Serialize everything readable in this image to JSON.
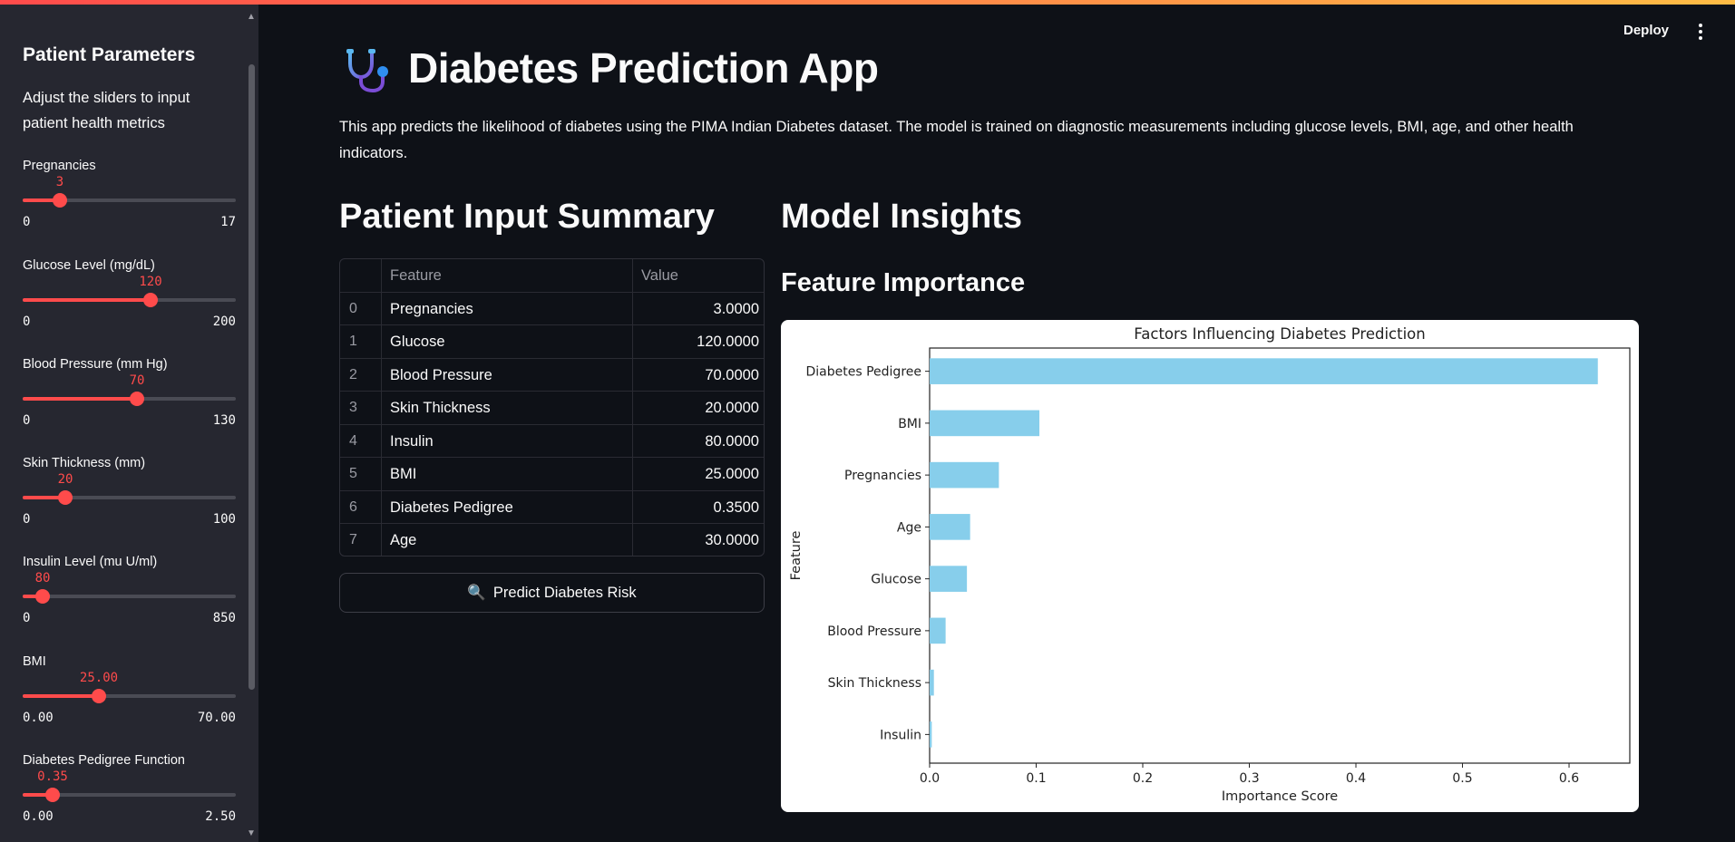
{
  "header": {
    "deploy_label": "Deploy"
  },
  "sidebar": {
    "title": "Patient Parameters",
    "description": "Adjust the sliders to input patient health metrics",
    "sliders": [
      {
        "label": "Pregnancies",
        "value": "3",
        "min": "0",
        "max": "17",
        "fraction": 0.176
      },
      {
        "label": "Glucose Level (mg/dL)",
        "value": "120",
        "min": "0",
        "max": "200",
        "fraction": 0.6
      },
      {
        "label": "Blood Pressure (mm Hg)",
        "value": "70",
        "min": "0",
        "max": "130",
        "fraction": 0.538
      },
      {
        "label": "Skin Thickness (mm)",
        "value": "20",
        "min": "0",
        "max": "100",
        "fraction": 0.2
      },
      {
        "label": "Insulin Level (mu U/ml)",
        "value": "80",
        "min": "0",
        "max": "850",
        "fraction": 0.094
      },
      {
        "label": "BMI",
        "value": "25.00",
        "min": "0.00",
        "max": "70.00",
        "fraction": 0.357
      },
      {
        "label": "Diabetes Pedigree Function",
        "value": "0.35",
        "min": "0.00",
        "max": "2.50",
        "fraction": 0.14
      }
    ]
  },
  "main": {
    "title": "Diabetes Prediction App",
    "description": "This app predicts the likelihood of diabetes using the PIMA Indian Diabetes dataset. The model is trained on diagnostic measurements including glucose levels, BMI, age, and other health indicators.",
    "left_heading": "Patient Input Summary",
    "right_heading": "Model Insights",
    "sub_heading": "Feature Importance",
    "table": {
      "columns": [
        "",
        "Feature",
        "Value"
      ],
      "rows": [
        {
          "idx": "0",
          "feature": "Pregnancies",
          "value": "3.0000"
        },
        {
          "idx": "1",
          "feature": "Glucose",
          "value": "120.0000"
        },
        {
          "idx": "2",
          "feature": "Blood Pressure",
          "value": "70.0000"
        },
        {
          "idx": "3",
          "feature": "Skin Thickness",
          "value": "20.0000"
        },
        {
          "idx": "4",
          "feature": "Insulin",
          "value": "80.0000"
        },
        {
          "idx": "5",
          "feature": "BMI",
          "value": "25.0000"
        },
        {
          "idx": "6",
          "feature": "Diabetes Pedigree",
          "value": "0.3500"
        },
        {
          "idx": "7",
          "feature": "Age",
          "value": "30.0000"
        }
      ]
    },
    "predict_button": {
      "icon": "🔍",
      "label": "Predict Diabetes Risk"
    }
  },
  "colors": {
    "accent": "#ff4b4b",
    "bar": "#87ceeb",
    "background": "#0e1117",
    "sidebar": "#262730"
  },
  "chart_data": {
    "type": "bar",
    "orientation": "horizontal",
    "title": "Factors Influencing Diabetes Prediction",
    "xlabel": "Importance Score",
    "ylabel": "Feature",
    "categories": [
      "Diabetes Pedigree",
      "BMI",
      "Pregnancies",
      "Age",
      "Glucose",
      "Blood Pressure",
      "Skin Thickness",
      "Insulin"
    ],
    "values": [
      0.627,
      0.103,
      0.065,
      0.038,
      0.035,
      0.015,
      0.004,
      0.002
    ],
    "xlim": [
      0,
      0.657
    ],
    "xticks": [
      "0.0",
      "0.1",
      "0.2",
      "0.3",
      "0.4",
      "0.5",
      "0.6"
    ]
  }
}
